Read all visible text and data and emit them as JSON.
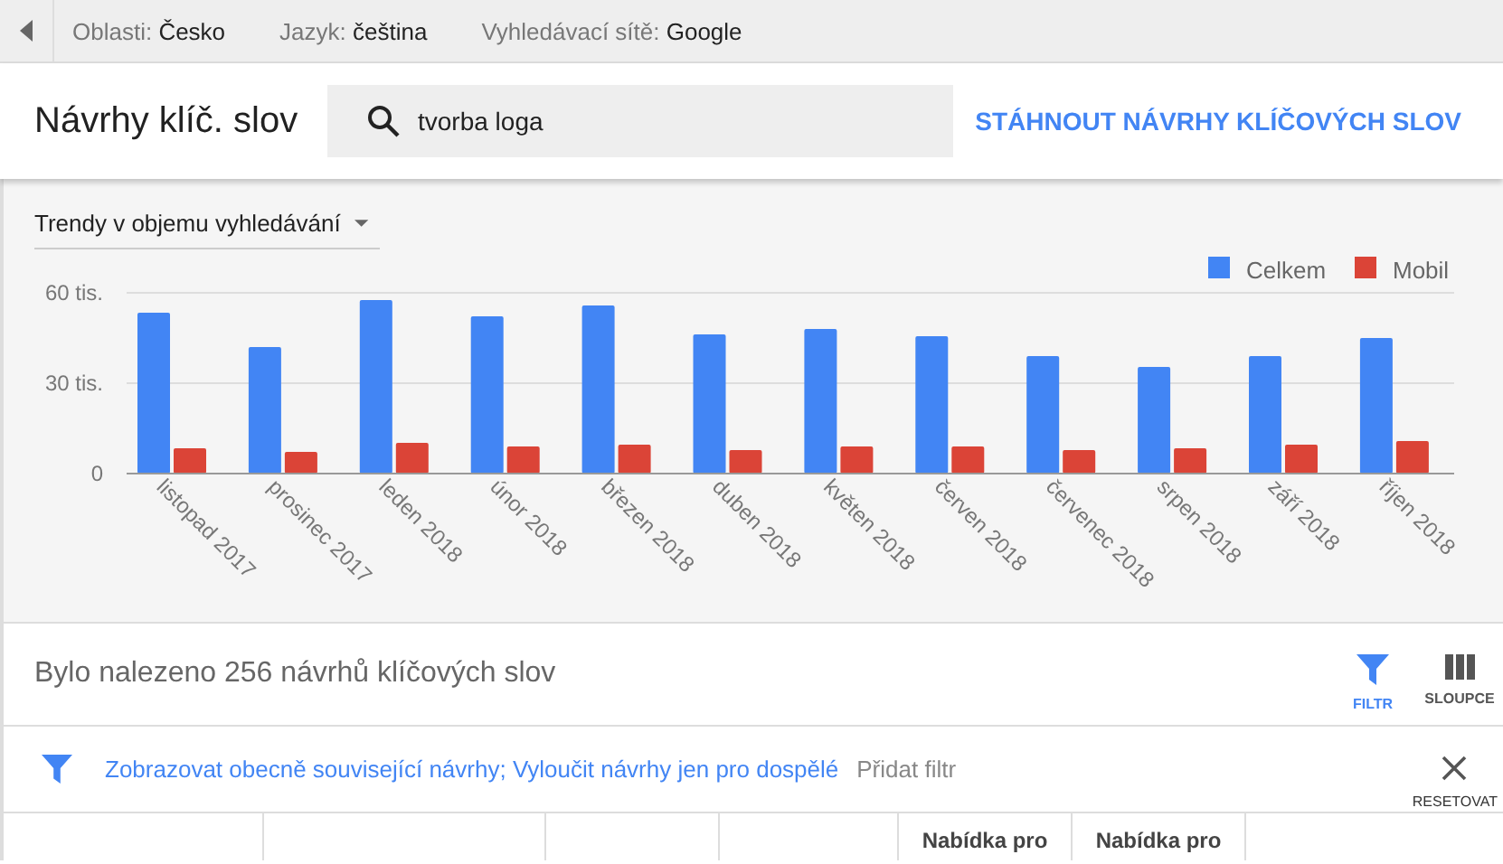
{
  "filters_bar": {
    "items": [
      {
        "label": "Oblasti:",
        "value": "Česko"
      },
      {
        "label": "Jazyk:",
        "value": "čeština"
      },
      {
        "label": "Vyhledávací sítě:",
        "value": "Google"
      }
    ]
  },
  "header": {
    "title": "Návrhy klíč. slov",
    "search": {
      "value": "tvorba loga"
    },
    "download_link": "STÁHNOUT NÁVRHY KLÍČOVÝCH SLOV"
  },
  "trend": {
    "dropdown": "Trendy v objemu vyhledávání",
    "chart_data": {
      "type": "bar",
      "categories": [
        "listopad 2017",
        "prosinec 2017",
        "leden 2018",
        "únor 2018",
        "březen 2018",
        "duben 2018",
        "květen 2018",
        "červen 2018",
        "červenec 2018",
        "srpen 2018",
        "září 2018",
        "říjen 2018"
      ],
      "yticks": [
        {
          "value": 0,
          "label": "0"
        },
        {
          "value": 30,
          "label": "30 tis."
        },
        {
          "value": 60,
          "label": "60 tis."
        }
      ],
      "ylim": [
        0,
        60
      ],
      "legend": "top-right",
      "series": [
        {
          "name": "Celkem",
          "color": "#4285f4",
          "values": [
            53.4,
            42,
            57.6,
            52.2,
            55.8,
            46.2,
            48,
            45.6,
            39,
            35.4,
            39,
            45
          ]
        },
        {
          "name": "Mobil",
          "color": "#db4437",
          "values": [
            8.4,
            7.2,
            10.2,
            9,
            9.6,
            7.8,
            9,
            9,
            7.8,
            8.4,
            9.6,
            10.8
          ]
        }
      ]
    }
  },
  "results": {
    "summary": "Bylo nalezeno 256 návrhů klíčových slov",
    "buttons": [
      {
        "kind": "filter",
        "label": "FILTR"
      },
      {
        "kind": "columns",
        "label": "SLOUPCE"
      }
    ]
  },
  "filter_row": {
    "active_filters": "Zobrazovat obecně související návrhy; Vyloučit návrhy jen pro dospělé",
    "add_filter": "Přidat filtr",
    "reset": "RESETOVAT"
  },
  "table": {
    "columns": [
      "Nabídka pro",
      "Nabídka pro"
    ]
  }
}
